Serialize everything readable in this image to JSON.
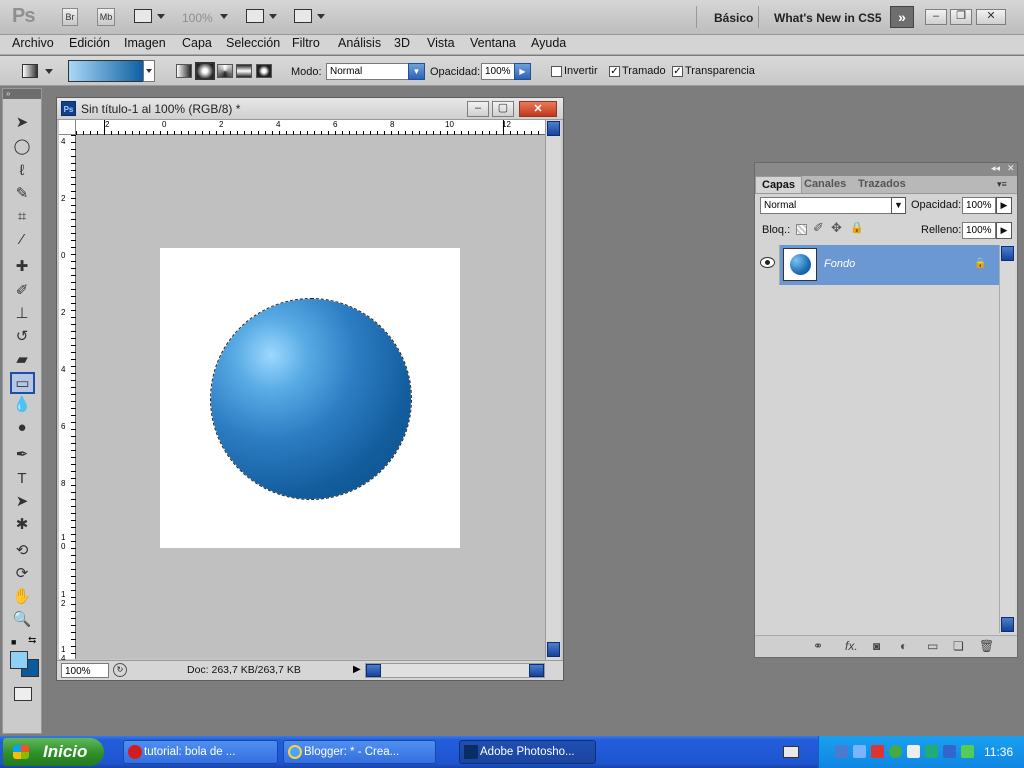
{
  "app": {
    "logo": "Ps",
    "bridge_btn": "Br",
    "minibridge_btn": "Mb",
    "zoom": "100%",
    "workspace": "Básico",
    "whats_new": "What's New in CS5",
    "more_glyph": "»"
  },
  "menu": [
    "Archivo",
    "Edición",
    "Imagen",
    "Capa",
    "Selección",
    "Filtro",
    "Análisis",
    "3D",
    "Vista",
    "Ventana",
    "Ayuda"
  ],
  "options": {
    "mode_label": "Modo:",
    "mode_value": "Normal",
    "opacity_label": "Opacidad:",
    "opacity_value": "100%",
    "invert_label": "Invertir",
    "invert_checked": false,
    "dither_label": "Tramado",
    "dither_checked": true,
    "transparency_label": "Transparencia",
    "transparency_checked": true,
    "gradient_start_color": "#a9d8f7",
    "gradient_end_color": "#0f5fa2"
  },
  "toolbar": {
    "tools": [
      "move-tool",
      "elliptical-marquee-tool",
      "lasso-tool",
      "quick-selection-tool",
      "crop-tool",
      "eyedropper-tool",
      "healing-brush-tool",
      "brush-tool",
      "clone-stamp-tool",
      "history-brush-tool",
      "eraser-tool",
      "gradient-tool",
      "blur-tool",
      "dodge-tool",
      "pen-tool",
      "type-tool",
      "path-selection-tool",
      "custom-shape-tool",
      "3d-rotate-tool",
      "3d-orbit-tool",
      "hand-tool",
      "zoom-tool"
    ],
    "active_tool": "gradient-tool",
    "foreground_color": "#8fd0f5",
    "background_color": "#0b5a9a"
  },
  "document": {
    "title": "Sin título-1 al 100% (RGB/8) *",
    "zoom": "100%",
    "doc_info": "Doc: 263,7 KB/263,7 KB",
    "ruler_top": [
      "2",
      "0",
      "2",
      "4",
      "6",
      "8",
      "10",
      "12"
    ],
    "ruler_left": [
      "4",
      "2",
      "0",
      "2",
      "4",
      "6",
      "8",
      "1\n0",
      "1\n2",
      "1\n4"
    ]
  },
  "layers": {
    "tabs": [
      "Capas",
      "Canales",
      "Trazados"
    ],
    "active_tab": "Capas",
    "blend_mode": "Normal",
    "opacity_label": "Opacidad:",
    "opacity_value": "100%",
    "lock_label": "Bloq.:",
    "fill_label": "Relleno:",
    "fill_value": "100%",
    "layer_name": "Fondo",
    "layer_visible": true,
    "layer_locked": true
  },
  "taskbar": {
    "start_label": "Inicio",
    "tasks": [
      {
        "label": "tutorial: bola de ...",
        "icon": "opera-icon",
        "active": false
      },
      {
        "label": "Blogger: * - Crea...",
        "icon": "ie-icon",
        "active": false
      },
      {
        "label": "Adobe Photosho...",
        "icon": "photoshop-icon",
        "active": true
      }
    ],
    "clock": "11:36"
  }
}
